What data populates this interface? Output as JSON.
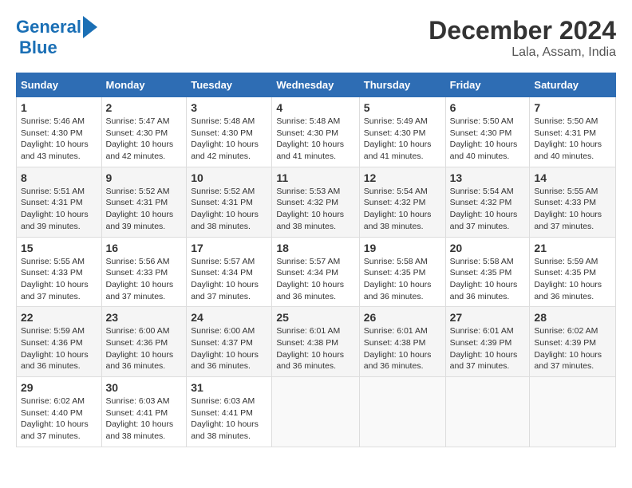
{
  "logo": {
    "line1": "General",
    "line2": "Blue"
  },
  "title": "December 2024",
  "subtitle": "Lala, Assam, India",
  "days_of_week": [
    "Sunday",
    "Monday",
    "Tuesday",
    "Wednesday",
    "Thursday",
    "Friday",
    "Saturday"
  ],
  "weeks": [
    [
      {
        "day": "1",
        "sunrise": "5:46 AM",
        "sunset": "4:30 PM",
        "daylight": "10 hours and 43 minutes."
      },
      {
        "day": "2",
        "sunrise": "5:47 AM",
        "sunset": "4:30 PM",
        "daylight": "10 hours and 42 minutes."
      },
      {
        "day": "3",
        "sunrise": "5:48 AM",
        "sunset": "4:30 PM",
        "daylight": "10 hours and 42 minutes."
      },
      {
        "day": "4",
        "sunrise": "5:48 AM",
        "sunset": "4:30 PM",
        "daylight": "10 hours and 41 minutes."
      },
      {
        "day": "5",
        "sunrise": "5:49 AM",
        "sunset": "4:30 PM",
        "daylight": "10 hours and 41 minutes."
      },
      {
        "day": "6",
        "sunrise": "5:50 AM",
        "sunset": "4:30 PM",
        "daylight": "10 hours and 40 minutes."
      },
      {
        "day": "7",
        "sunrise": "5:50 AM",
        "sunset": "4:31 PM",
        "daylight": "10 hours and 40 minutes."
      }
    ],
    [
      {
        "day": "8",
        "sunrise": "5:51 AM",
        "sunset": "4:31 PM",
        "daylight": "10 hours and 39 minutes."
      },
      {
        "day": "9",
        "sunrise": "5:52 AM",
        "sunset": "4:31 PM",
        "daylight": "10 hours and 39 minutes."
      },
      {
        "day": "10",
        "sunrise": "5:52 AM",
        "sunset": "4:31 PM",
        "daylight": "10 hours and 38 minutes."
      },
      {
        "day": "11",
        "sunrise": "5:53 AM",
        "sunset": "4:32 PM",
        "daylight": "10 hours and 38 minutes."
      },
      {
        "day": "12",
        "sunrise": "5:54 AM",
        "sunset": "4:32 PM",
        "daylight": "10 hours and 38 minutes."
      },
      {
        "day": "13",
        "sunrise": "5:54 AM",
        "sunset": "4:32 PM",
        "daylight": "10 hours and 37 minutes."
      },
      {
        "day": "14",
        "sunrise": "5:55 AM",
        "sunset": "4:33 PM",
        "daylight": "10 hours and 37 minutes."
      }
    ],
    [
      {
        "day": "15",
        "sunrise": "5:55 AM",
        "sunset": "4:33 PM",
        "daylight": "10 hours and 37 minutes."
      },
      {
        "day": "16",
        "sunrise": "5:56 AM",
        "sunset": "4:33 PM",
        "daylight": "10 hours and 37 minutes."
      },
      {
        "day": "17",
        "sunrise": "5:57 AM",
        "sunset": "4:34 PM",
        "daylight": "10 hours and 37 minutes."
      },
      {
        "day": "18",
        "sunrise": "5:57 AM",
        "sunset": "4:34 PM",
        "daylight": "10 hours and 36 minutes."
      },
      {
        "day": "19",
        "sunrise": "5:58 AM",
        "sunset": "4:35 PM",
        "daylight": "10 hours and 36 minutes."
      },
      {
        "day": "20",
        "sunrise": "5:58 AM",
        "sunset": "4:35 PM",
        "daylight": "10 hours and 36 minutes."
      },
      {
        "day": "21",
        "sunrise": "5:59 AM",
        "sunset": "4:35 PM",
        "daylight": "10 hours and 36 minutes."
      }
    ],
    [
      {
        "day": "22",
        "sunrise": "5:59 AM",
        "sunset": "4:36 PM",
        "daylight": "10 hours and 36 minutes."
      },
      {
        "day": "23",
        "sunrise": "6:00 AM",
        "sunset": "4:36 PM",
        "daylight": "10 hours and 36 minutes."
      },
      {
        "day": "24",
        "sunrise": "6:00 AM",
        "sunset": "4:37 PM",
        "daylight": "10 hours and 36 minutes."
      },
      {
        "day": "25",
        "sunrise": "6:01 AM",
        "sunset": "4:38 PM",
        "daylight": "10 hours and 36 minutes."
      },
      {
        "day": "26",
        "sunrise": "6:01 AM",
        "sunset": "4:38 PM",
        "daylight": "10 hours and 36 minutes."
      },
      {
        "day": "27",
        "sunrise": "6:01 AM",
        "sunset": "4:39 PM",
        "daylight": "10 hours and 37 minutes."
      },
      {
        "day": "28",
        "sunrise": "6:02 AM",
        "sunset": "4:39 PM",
        "daylight": "10 hours and 37 minutes."
      }
    ],
    [
      {
        "day": "29",
        "sunrise": "6:02 AM",
        "sunset": "4:40 PM",
        "daylight": "10 hours and 37 minutes."
      },
      {
        "day": "30",
        "sunrise": "6:03 AM",
        "sunset": "4:41 PM",
        "daylight": "10 hours and 38 minutes."
      },
      {
        "day": "31",
        "sunrise": "6:03 AM",
        "sunset": "4:41 PM",
        "daylight": "10 hours and 38 minutes."
      },
      null,
      null,
      null,
      null
    ]
  ]
}
